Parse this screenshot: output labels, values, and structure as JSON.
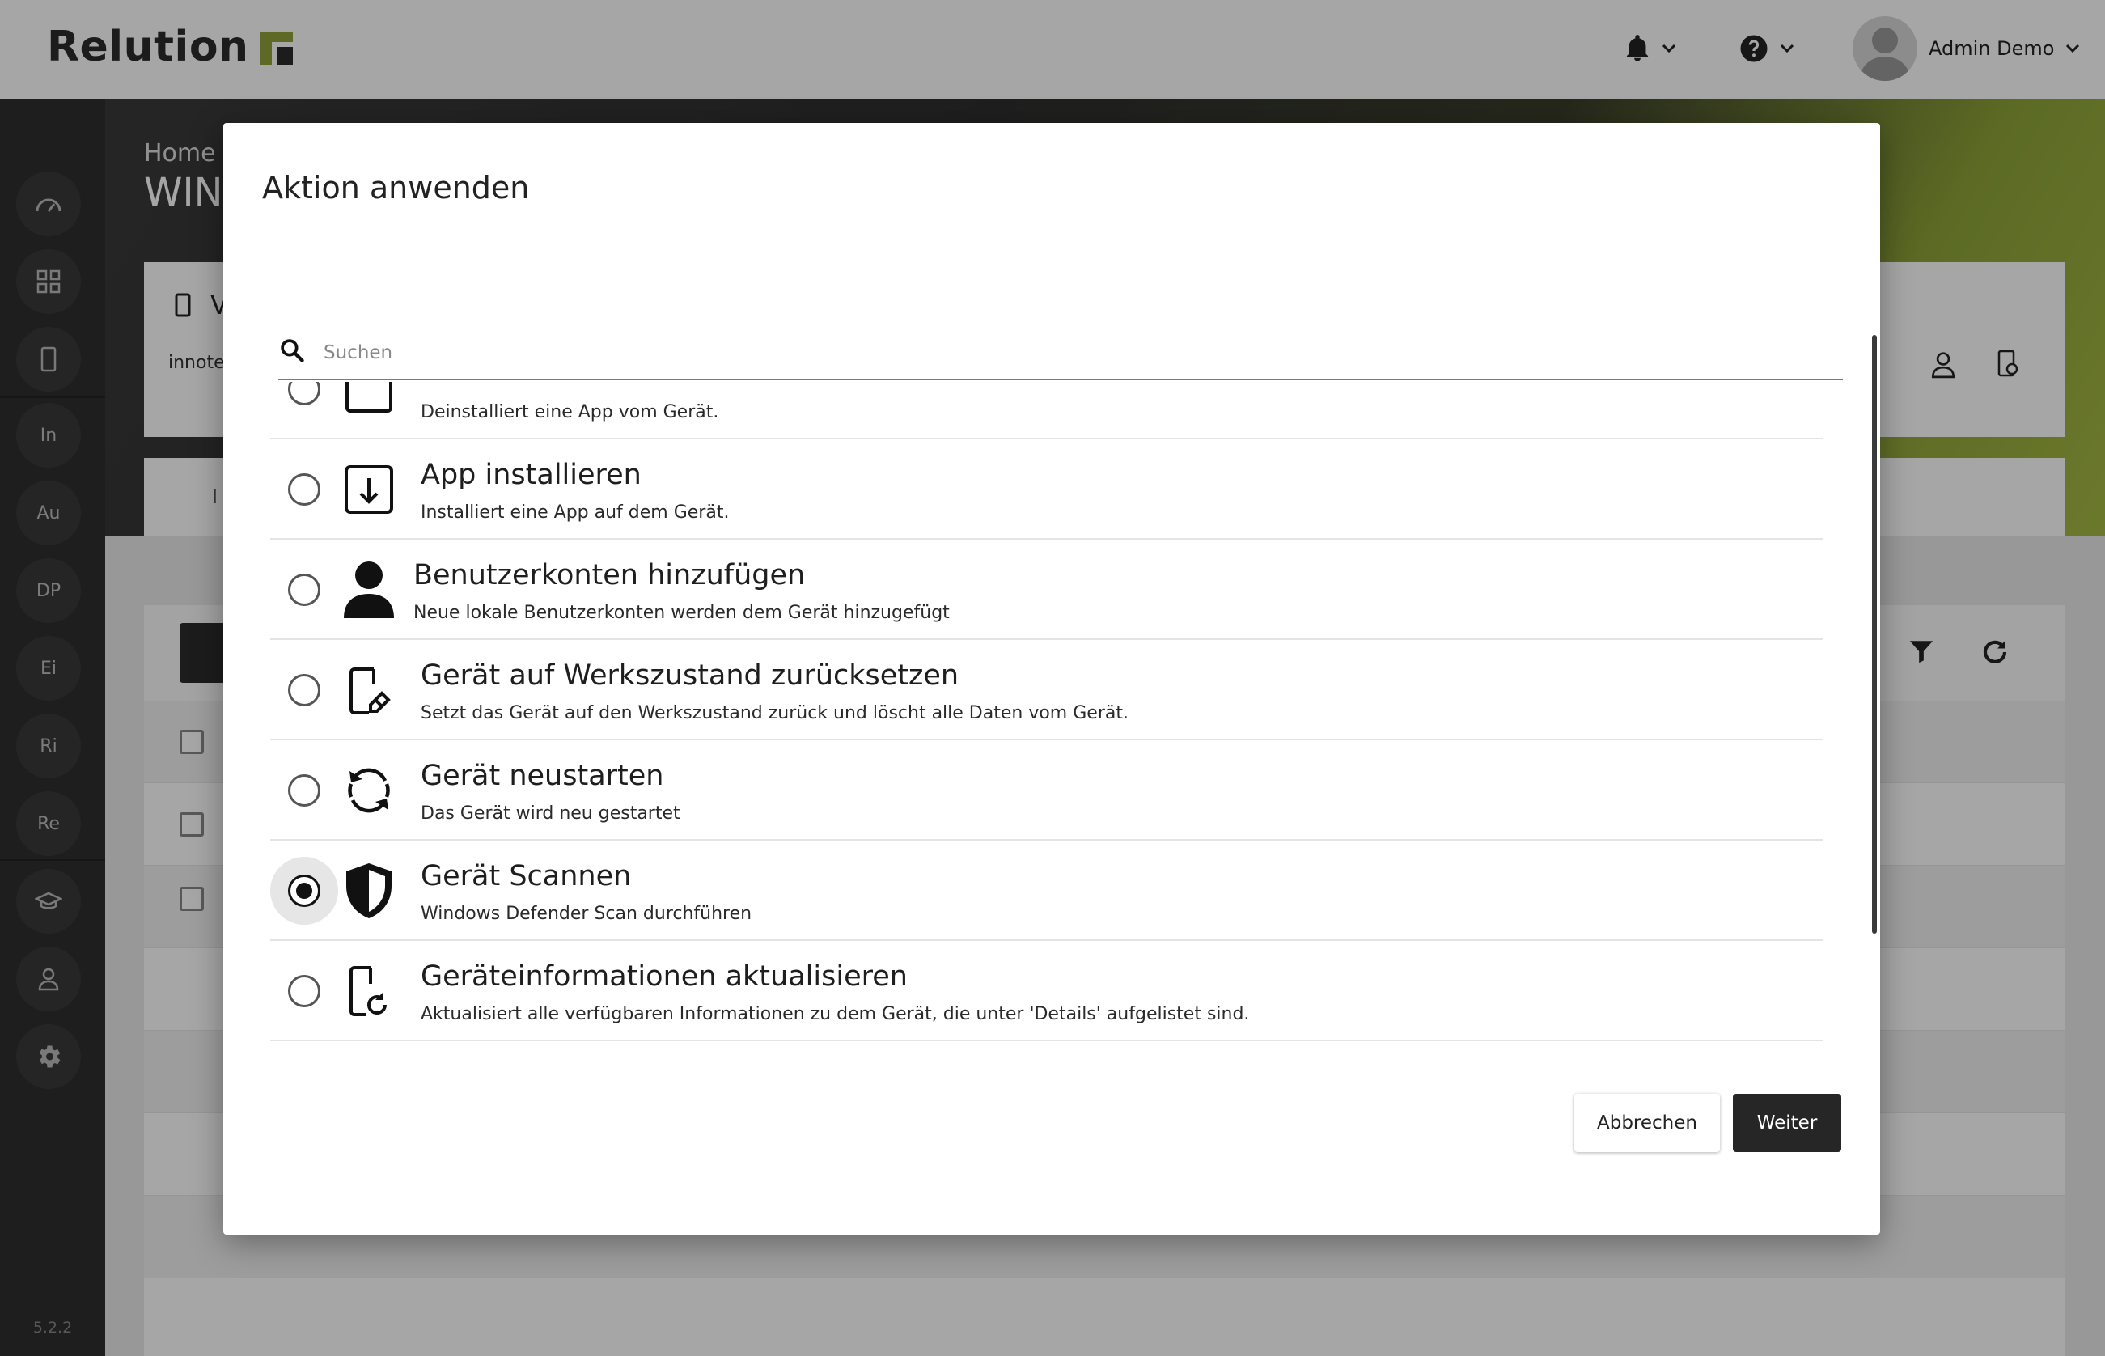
{
  "app": {
    "logo_text": "Relution",
    "version": "5.2.2"
  },
  "header": {
    "user_name": "Admin Demo"
  },
  "sidebar": {
    "items": [
      {
        "label": "In"
      },
      {
        "label": "Au"
      },
      {
        "label": "DP"
      },
      {
        "label": "Ei"
      },
      {
        "label": "Ri"
      },
      {
        "label": "Re"
      }
    ]
  },
  "page": {
    "breadcrumb_home": "Home",
    "title": "WIN",
    "card_title": "V",
    "card_text": "innote",
    "tab_label": "I"
  },
  "dialog": {
    "title": "Aktion anwenden",
    "search": {
      "placeholder": "Suchen",
      "value": ""
    },
    "actions": [
      {
        "title": "",
        "desc": "Deinstalliert eine App vom Gerät.",
        "icon": "app-uninstall-icon",
        "selected": false
      },
      {
        "title": "App installieren",
        "desc": "Installiert eine App auf dem Gerät.",
        "icon": "app-install-icon",
        "selected": false
      },
      {
        "title": "Benutzerkonten hinzufügen",
        "desc": "Neue lokale Benutzerkonten werden dem Gerät hinzugefügt",
        "icon": "user-account-icon",
        "selected": false
      },
      {
        "title": "Gerät auf Werkszustand zurücksetzen",
        "desc": "Setzt das Gerät auf den Werkszustand zurück und löscht alle Daten vom Gerät.",
        "icon": "factory-reset-icon",
        "selected": false
      },
      {
        "title": "Gerät neustarten",
        "desc": "Das Gerät wird neu gestartet",
        "icon": "restart-icon",
        "selected": false
      },
      {
        "title": "Gerät Scannen",
        "desc": "Windows Defender Scan durchführen",
        "icon": "shield-icon",
        "selected": true
      },
      {
        "title": "Geräteinformationen aktualisieren",
        "desc": "Aktualisiert alle verfügbaren Informationen zu dem Gerät, die unter 'Details' aufgelistet sind.",
        "icon": "device-refresh-icon",
        "selected": false
      }
    ],
    "cancel_label": "Abbrechen",
    "next_label": "Weiter"
  }
}
